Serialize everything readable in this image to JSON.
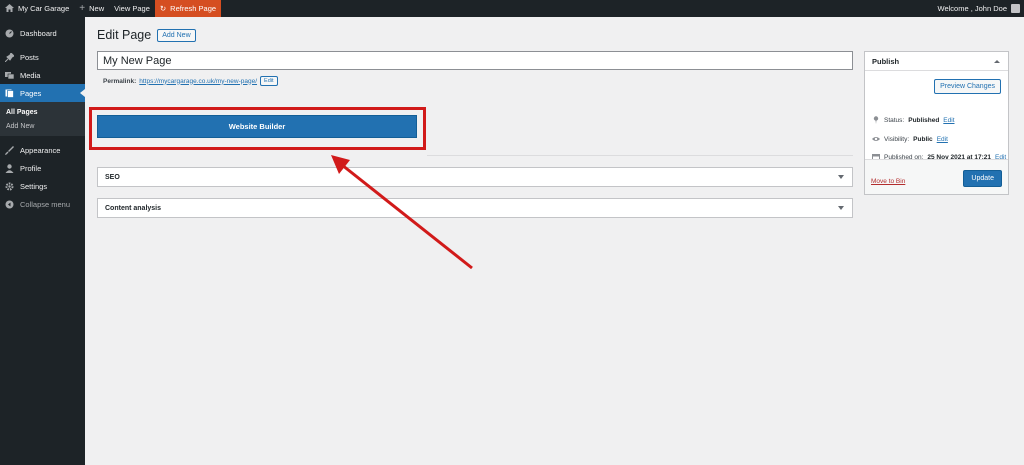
{
  "adminbar": {
    "site_name": "My Car Garage",
    "new_label": "New",
    "view_page_label": "View Page",
    "refresh_label": "Refresh Page",
    "welcome": "Welcome , John Doe"
  },
  "sidebar": {
    "items": [
      {
        "label": "Dashboard",
        "icon": "dashboard-icon"
      },
      {
        "label": "Posts",
        "icon": "pin-icon"
      },
      {
        "label": "Media",
        "icon": "media-icon"
      },
      {
        "label": "Pages",
        "icon": "pages-icon"
      },
      {
        "label": "Appearance",
        "icon": "brush-icon"
      },
      {
        "label": "Profile",
        "icon": "user-icon"
      },
      {
        "label": "Settings",
        "icon": "settings-icon"
      },
      {
        "label": "Collapse menu",
        "icon": "collapse-icon"
      }
    ],
    "submenu": [
      "All Pages",
      "Add New"
    ]
  },
  "main": {
    "page_title": "Edit Page",
    "add_new_label": "Add New",
    "title_value": "My New Page",
    "permalink_label": "Permalink:",
    "permalink_url": "https://mycargarage.co.uk/my-new-page/",
    "permalink_edit": "Edit",
    "builder_label": "Website Builder",
    "panels": [
      "SEO",
      "Content analysis"
    ]
  },
  "publish": {
    "title": "Publish",
    "preview_label": "Preview Changes",
    "status_label": "Status:",
    "status_value": "Published",
    "visibility_label": "Visibility:",
    "visibility_value": "Public",
    "published_label": "Published on:",
    "published_value": "25 Nov 2021 at 17:21",
    "edit_label": "Edit",
    "move_to_bin": "Move to Bin",
    "update_label": "Update"
  },
  "colors": {
    "accent": "#2271b1",
    "adminbar": "#1d2327",
    "highlight": "#d11a1a",
    "refresh": "#d54e21"
  }
}
